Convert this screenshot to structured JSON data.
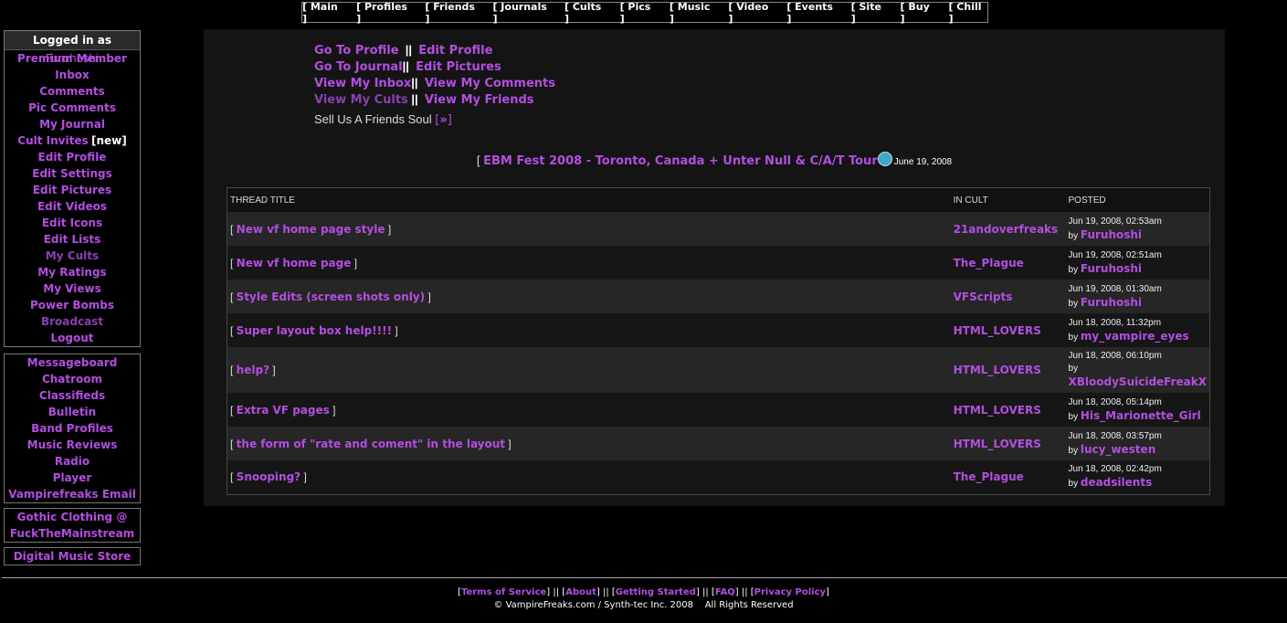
{
  "topnav": [
    "[ Main ]",
    "[ Profiles ]",
    "[ Friends ]",
    "[ Journals ]",
    "[ Cults ]",
    "[ Pics ]",
    "[ Music ]",
    "[ Video ]",
    "[ Events ]",
    "[ Site ]",
    "[ Buy ]",
    "[ Chill ]"
  ],
  "sidebar": {
    "logged_in_prefix": "Logged in as",
    "username": "Furuhoshi",
    "account_links": [
      "Premium Member",
      "Inbox",
      "Comments",
      "Pic Comments",
      "My Journal",
      "Cult Invites",
      "Edit Profile",
      "Edit Settings",
      "Edit Pictures",
      "Edit Videos",
      "Edit Icons",
      "Edit Lists",
      "My Cults",
      "My Ratings",
      "My Views",
      "Power Bombs",
      "Broadcast",
      "Logout"
    ],
    "new_tag": "[new]",
    "community_links": [
      "Messageboard",
      "Chatroom",
      "Classifieds",
      "Bulletin",
      "Band Profiles",
      "Music Reviews",
      "Radio",
      "Player",
      "Vampirefreaks Email"
    ],
    "clothing_line1": "Gothic Clothing @",
    "clothing_line2": "FuckTheMainstream",
    "music_store": "Digital Music Store"
  },
  "quick_links": {
    "go_to_profile": "Go To Profile",
    "edit_profile": "Edit Profile",
    "go_to_journal": "Go To Journal",
    "edit_pictures": "Edit Pictures",
    "view_inbox": "View My Inbox",
    "view_comments": "View My Comments",
    "view_cults": "View My Cults",
    "view_friends": "View My Friends",
    "sep": "||",
    "sell_soul": "Sell Us A Friends Soul",
    "sell_soul_open": "[",
    "sell_soul_arrow": "»",
    "sell_soul_close": "]"
  },
  "news": {
    "open": "[",
    "title": "EBM Fest 2008 - Toronto, Canada + Unter Null & C/A/T Tour",
    "date": "June 19, 2008"
  },
  "threads": {
    "headers": {
      "title": "THREAD TITLE",
      "cult": "IN CULT",
      "posted": "POSTED"
    },
    "by": "by",
    "rows": [
      {
        "title": "New vf home page style",
        "cult": "21andoverfreaks",
        "date": "Jun 19, 2008, 02:53am",
        "user": "Furuhoshi"
      },
      {
        "title": "New vf home page",
        "cult": "The_Plague",
        "date": "Jun 19, 2008, 02:51am",
        "user": "Furuhoshi"
      },
      {
        "title": "Style Edits (screen shots only)",
        "cult": "VFScripts",
        "date": "Jun 19, 2008, 01:30am",
        "user": "Furuhoshi"
      },
      {
        "title": "Super layout box help!!!!",
        "cult": "HTML_LOVERS",
        "date": "Jun 18, 2008, 11:32pm",
        "user": "my_vampire_eyes"
      },
      {
        "title": "help?",
        "cult": "HTML_LOVERS",
        "date": "Jun 18, 2008, 06:10pm",
        "user": "XBloodySuicideFreakX"
      },
      {
        "title": "Extra VF pages",
        "cult": "HTML_LOVERS",
        "date": "Jun 18, 2008, 05:14pm",
        "user": "His_Marionette_Girl"
      },
      {
        "title": "the form of \"rate and coment\" in the layout",
        "cult": "HTML_LOVERS",
        "date": "Jun 18, 2008, 03:57pm",
        "user": "lucy_westen"
      },
      {
        "title": "Snooping?",
        "cult": "The_Plague",
        "date": "Jun 18, 2008, 02:42pm",
        "user": "deadsilents"
      }
    ]
  },
  "footer": {
    "links": [
      "Terms of Service",
      "About",
      "Getting Started",
      "FAQ",
      "Privacy Policy"
    ],
    "copyright": "© VampireFreaks.com / Synth-tec Inc. 2008    All Rights Reserved"
  },
  "colors": {
    "link": "#b34ee0",
    "background": "#000000",
    "panel": "#141414"
  }
}
